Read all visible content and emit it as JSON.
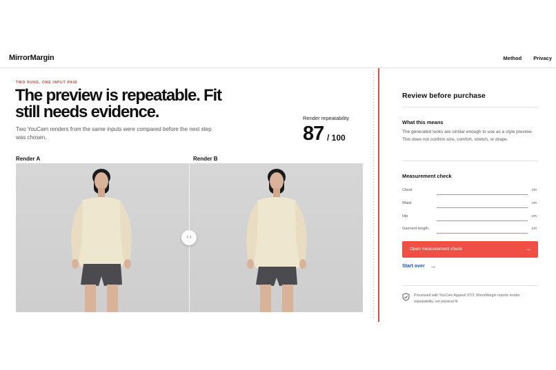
{
  "header": {
    "logo": "MirrorMargin",
    "nav": [
      "Method",
      "Privacy"
    ]
  },
  "hero": {
    "eyebrow": "TWO RUNS, ONE INPUT PAIR",
    "headline": "The preview is repeatable. Fit still needs evidence.",
    "subtext": "Two YouCam renders from the same inputs were compared before the next step was chosen."
  },
  "score": {
    "label": "Render repeatability",
    "value": "87",
    "denominator": "/ 100"
  },
  "renders": {
    "a_label": "Render A",
    "b_label": "Render B",
    "handle_left": "‹",
    "handle_right": "›"
  },
  "panel": {
    "title": "Review before purchase",
    "meaning_heading": "What this means",
    "meaning_text": "The generated looks are similar enough to use as a style preview. This does not confirm size, comfort, stretch, or drape.",
    "measurement_heading": "Measurement check",
    "fields": [
      {
        "label": "Chest",
        "unit": "cm",
        "value": ""
      },
      {
        "label": "Waist",
        "unit": "cm",
        "value": ""
      },
      {
        "label": "Hip",
        "unit": "cm",
        "value": ""
      },
      {
        "label": "Garment length",
        "unit": "cm",
        "value": ""
      }
    ],
    "cta_label": "Open measurement check",
    "cta_arrow": "→",
    "start_over": "Start over",
    "start_over_arrow": "→",
    "footnote": "Processed with YouCam Apparel VTO. MirrorMargin reports render repeatability, not physical fit."
  },
  "colors": {
    "accent": "#ef4f45",
    "link": "#1f4fb8",
    "sweater": "#efe6cf",
    "shorts": "#4a4a4f"
  }
}
